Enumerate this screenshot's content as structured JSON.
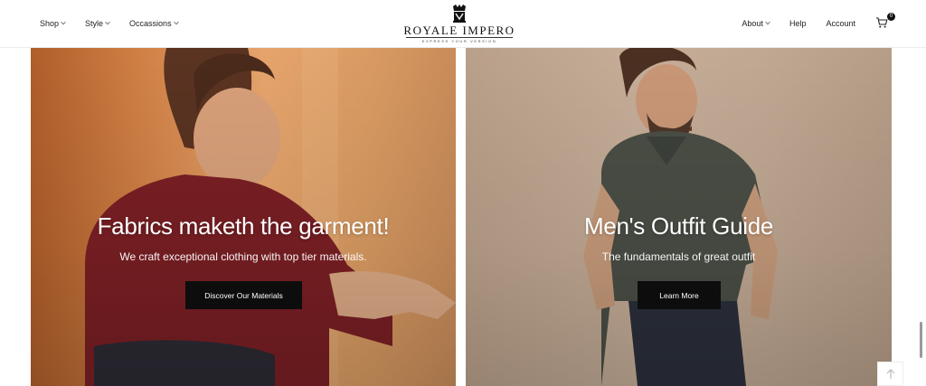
{
  "header": {
    "nav_left": [
      {
        "label": "Shop",
        "dropdown": true
      },
      {
        "label": "Style",
        "dropdown": true
      },
      {
        "label": "Occassions",
        "dropdown": true
      }
    ],
    "nav_right": [
      {
        "label": "About",
        "dropdown": true
      },
      {
        "label": "Help",
        "dropdown": false
      },
      {
        "label": "Account",
        "dropdown": false
      }
    ],
    "logo": {
      "name": "ROYALE IMPERO",
      "tagline": "EXPRESS YOUR VERSION"
    },
    "cart": {
      "icon": "cart-icon",
      "count": "0"
    }
  },
  "cards": [
    {
      "title": "Fabrics maketh the garment!",
      "subtitle": "We craft exceptional clothing with top tier materials.",
      "button": "Discover Our Materials"
    },
    {
      "title": "Men's Outfit Guide",
      "subtitle": "The fundamentals of great outfit",
      "button": "Learn More"
    }
  ],
  "scroll_top": {
    "icon": "arrow-up-icon"
  },
  "colors": {
    "button_bg": "#0d0d0d",
    "card_left_tone": "#cf7f44",
    "card_right_tone": "#c5ad98"
  }
}
